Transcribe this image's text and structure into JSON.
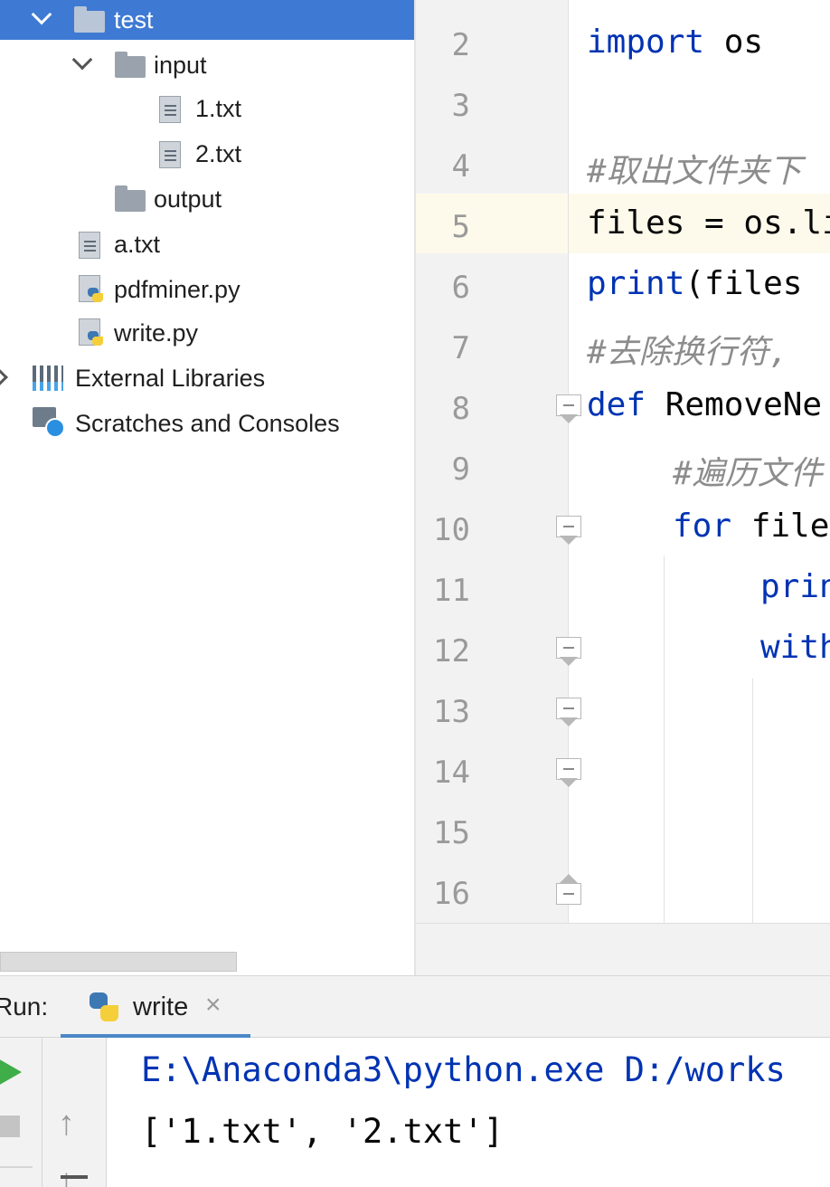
{
  "project_tree": {
    "items": [
      {
        "label": "test",
        "icon": "folder-icon",
        "expanded": true,
        "selected": true
      },
      {
        "label": "input",
        "icon": "folder-icon",
        "expanded": true
      },
      {
        "label": "1.txt",
        "icon": "text-file-icon"
      },
      {
        "label": "2.txt",
        "icon": "text-file-icon"
      },
      {
        "label": "output",
        "icon": "folder-icon"
      },
      {
        "label": "a.txt",
        "icon": "text-file-icon"
      },
      {
        "label": "pdfminer.py",
        "icon": "python-file-icon"
      },
      {
        "label": "write.py",
        "icon": "python-file-icon"
      },
      {
        "label": "External Libraries",
        "icon": "libraries-icon",
        "expanded": false
      },
      {
        "label": "Scratches and Consoles",
        "icon": "scratches-icon"
      }
    ]
  },
  "editor": {
    "current_line": "5",
    "lines": [
      {
        "num": "2",
        "kw": "import",
        "text": " os"
      },
      {
        "num": "3",
        "text": ""
      },
      {
        "num": "4",
        "comment": "#取出文件夹下"
      },
      {
        "num": "5",
        "text": "files = os.li"
      },
      {
        "num": "6",
        "kw": "print",
        "text": "(files"
      },
      {
        "num": "7",
        "comment": "#去除换行符,"
      },
      {
        "num": "8",
        "kw": "def",
        "text": " RemoveNe"
      },
      {
        "num": "9",
        "comment": "#遍历文件"
      },
      {
        "num": "10",
        "kw": "for",
        "text": " file"
      },
      {
        "num": "11",
        "kw": "prin",
        "text": ""
      },
      {
        "num": "12",
        "kw": "with",
        "text": ""
      },
      {
        "num": "13",
        "text": ""
      },
      {
        "num": "14",
        "text": ""
      },
      {
        "num": "15",
        "text": ""
      },
      {
        "num": "16",
        "text": ""
      }
    ]
  },
  "run_panel": {
    "label": "Run:",
    "tab_label": "write",
    "tab_close": "×",
    "up_arrow": "↑",
    "down_arrow": "↓",
    "console_lines": [
      "E:\\Anaconda3\\python.exe D:/works",
      "['1.txt', '2.txt']"
    ]
  },
  "colors": {
    "selection": "#3e7ad3",
    "keyword": "#0033b3",
    "comment": "#8c8c8c",
    "console_path": "#0033b3",
    "current_line_bg": "#fdfaeb",
    "run_green": "#3fae49"
  }
}
